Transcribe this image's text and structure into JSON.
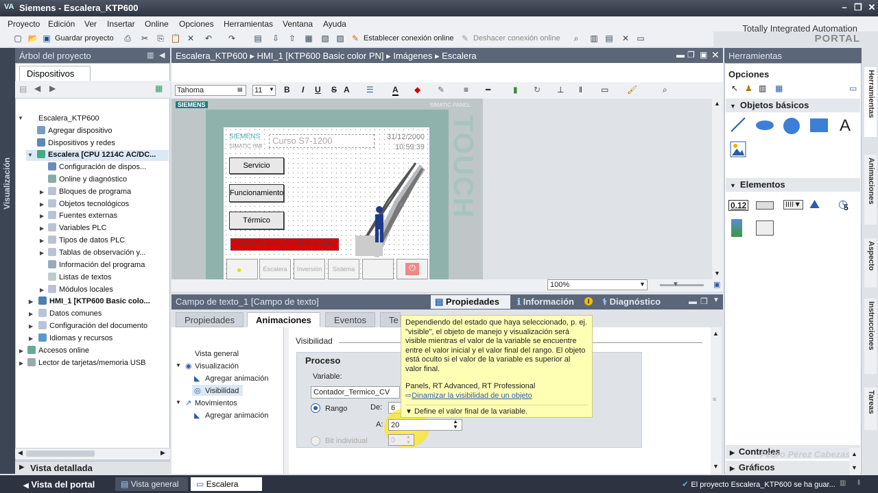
{
  "app": {
    "logo": "VA",
    "title": "Siemens  -  Escalera_KTP600"
  },
  "menu": [
    "Proyecto",
    "Edición",
    "Ver",
    "Insertar",
    "Online",
    "Opciones",
    "Herramientas",
    "Ventana",
    "Ayuda"
  ],
  "brand": {
    "line1": "Totally Integrated Automation",
    "line2": "PORTAL"
  },
  "toolbar": {
    "save": "Guardar proyecto",
    "connect": "Establecer conexión online",
    "disconnect": "Deshacer conexión online"
  },
  "tree": {
    "header": "Árbol del proyecto",
    "tab": "Dispositivos",
    "side_label": "Visualización",
    "items": [
      {
        "label": "Escalera_KTP600"
      },
      {
        "label": "Agregar dispositivo"
      },
      {
        "label": "Dispositivos y redes"
      },
      {
        "label": "Escalera [CPU 1214C AC/DC..."
      },
      {
        "label": "Configuración de dispos..."
      },
      {
        "label": "Online y diagnóstico"
      },
      {
        "label": "Bloques de programa"
      },
      {
        "label": "Objetos tecnológicos"
      },
      {
        "label": "Fuentes externas"
      },
      {
        "label": "Variables PLC"
      },
      {
        "label": "Tipos de datos PLC"
      },
      {
        "label": "Tablas de observación y..."
      },
      {
        "label": "Información del programa"
      },
      {
        "label": "Listas de textos"
      },
      {
        "label": "Módulos locales"
      },
      {
        "label": "HMI_1 [KTP600 Basic colo..."
      },
      {
        "label": "Datos comunes"
      },
      {
        "label": "Configuración del documento"
      },
      {
        "label": "Idiomas y recursos"
      },
      {
        "label": "Accesos online"
      },
      {
        "label": "Lector de tarjetas/memoria USB"
      }
    ],
    "detail": "Vista detallada"
  },
  "editor": {
    "breadcrumb": "Escalera_KTP600  ▸  HMI_1 [KTP600 Basic color PN]  ▸  Imágenes  ▸  Escalera",
    "font": "Tahoma",
    "font_size": "11",
    "zoom": "100%",
    "panel": {
      "brand": "SIEMENS",
      "simatic": "SIMATIC PANEL",
      "touch": "TOUCH",
      "screen_brand": "SIEMENS",
      "screen_sub": "SIMATIC HMI",
      "course": "Curso S7-1200",
      "date": "31/12/2000",
      "time": "10:59:39",
      "buttons": [
        "Servicio",
        "Funcionamiento",
        "Térmico"
      ],
      "alarm": "Reparar Avería y Reset Contador",
      "footer": [
        "Escalera",
        "Inversión",
        "Sistema"
      ]
    }
  },
  "inspector": {
    "title": "Campo de texto_1 [Campo de texto]",
    "main_tabs": [
      "Propiedades",
      "Información",
      "Diagnóstico"
    ],
    "sub_tabs": [
      "Propiedades",
      "Animaciones",
      "Eventos",
      "Te"
    ],
    "nav": [
      "Vista general",
      "Visualización",
      "Agregar animación",
      "Visibilidad",
      "Movimientos",
      "Agregar animación"
    ],
    "section": "Visibilidad",
    "process": "Proceso",
    "variable_label": "Variable:",
    "variable_value": "Contador_Termico_CV",
    "range_label": "Rango",
    "bit_label": "Bit individual",
    "from_label": "De:",
    "from_value": "6",
    "to_label": "A:",
    "to_value": "20",
    "bit_value": "0"
  },
  "tooltip": {
    "body": "Dependiendo del estado que haya seleccionado, p. ej. \"visible\", el objeto de manejo y visualización será visible mientras el valor de la variable se encuentre entre el valor inicial y el valor final del rango. El objeto está oculto si el valor de la variable es superior al valor final.",
    "platforms": "Panels,  RT Advanced,  RT Professional",
    "link": "Dinamizar la visibilidad de un objeto",
    "hint": "Define el valor final de la variable."
  },
  "tools": {
    "header": "Herramientas",
    "options": "Opciones",
    "sections": [
      "Objetos básicos",
      "Elementos",
      "Controles",
      "Gráficos"
    ],
    "side_tabs": [
      "Herramientas",
      "Animaciones",
      "Aspecto",
      "Instrucciones",
      "Tareas"
    ],
    "watermark": "Pedro Pérez Cabezas",
    "text_tool": "A",
    "io_field": "0.12",
    "clock_num": "5"
  },
  "statusbar": {
    "portal": "Vista del portal",
    "tabs": [
      "Vista general",
      "Escalera"
    ],
    "message": "El proyecto Escalera_KTP600 se ha guar..."
  }
}
